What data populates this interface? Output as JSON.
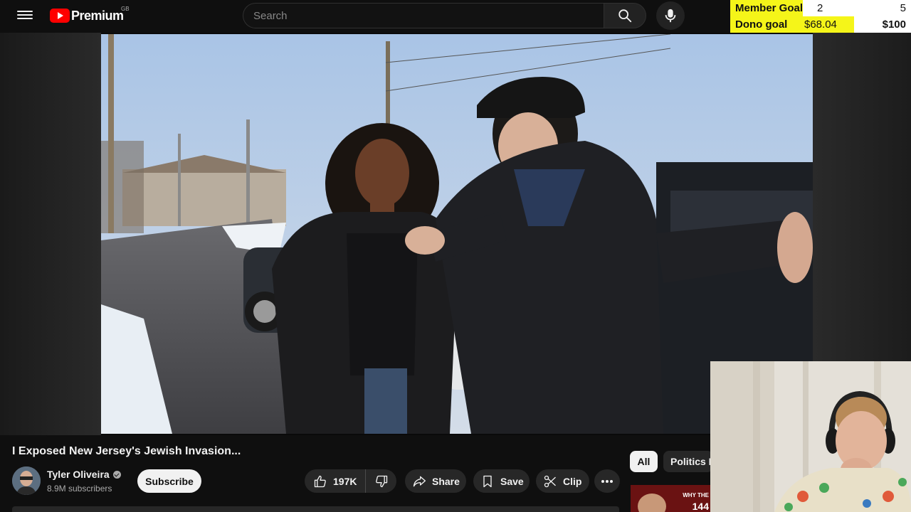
{
  "header": {
    "logo_text": "Premium",
    "region": "GB",
    "search_placeholder": "Search",
    "icons": [
      "menu-icon",
      "search-icon",
      "mic-icon"
    ]
  },
  "overlay_goals": {
    "member": {
      "label": "Member Goal",
      "current": "2",
      "target": "5",
      "progress": 0.4
    },
    "dono": {
      "label": "Dono goal",
      "current": "$68.04",
      "target": "$100",
      "progress": 0.6804
    },
    "fill_color": "#f5f519"
  },
  "video": {
    "title": "I Exposed New Jersey's Jewish Invasion...",
    "channel": {
      "name": "Tyler Oliveira",
      "subscribers": "8.9M subscribers",
      "verified": true
    },
    "subscribe_label": "Subscribe",
    "actions": {
      "likes": "197K",
      "share": "Share",
      "save": "Save",
      "clip": "Clip"
    }
  },
  "recommendations": {
    "chips": [
      "All",
      "Politics N"
    ],
    "thumb_text": "WHY THE",
    "thumb_num": "144"
  }
}
